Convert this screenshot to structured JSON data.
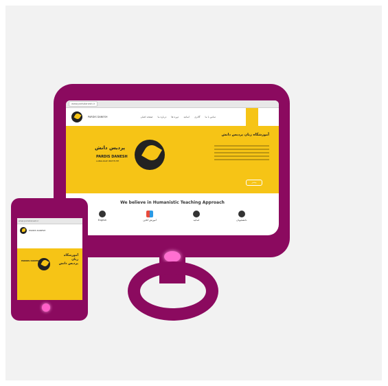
{
  "desktop": {
    "browser_url": "www.parisdanesh.ir",
    "nav": {
      "logo_text": "PARDIS DANESH",
      "items": [
        "صفحه اصلی",
        "درباره ما",
        "دوره ها",
        "اساتید",
        "گالری",
        "تماس با ما"
      ]
    },
    "hero": {
      "title": "آموزشگاه زبان پردیس دانش",
      "brand_fa": "پردیس دانش",
      "brand_en": "PARDIS DANESH",
      "brand_sub": "LANGUAGE INSTITUTE",
      "button": "بیشتر"
    },
    "tagline": "We believe in Humanistic Teaching Approach",
    "features": [
      {
        "icon": "headphones-icon",
        "label": "English"
      },
      {
        "icon": "apps-icon",
        "label": "آموزش آنلاین"
      },
      {
        "icon": "teacher-icon",
        "label": "اساتید"
      },
      {
        "icon": "graduate-icon",
        "label": "دانشجویان"
      }
    ]
  },
  "phone": {
    "browser_url": "www.parisdanesh.ir",
    "logo_text": "PARDIS DANESH",
    "hero_title": "آموزشگاه\nزبان\nپردیس دانش",
    "brand_en": "PARDIS DANESH"
  },
  "colors": {
    "device": "#8b0a5f",
    "accent": "#f6c416",
    "glow": "#ff6fd0",
    "background": "#f2f2f2"
  }
}
